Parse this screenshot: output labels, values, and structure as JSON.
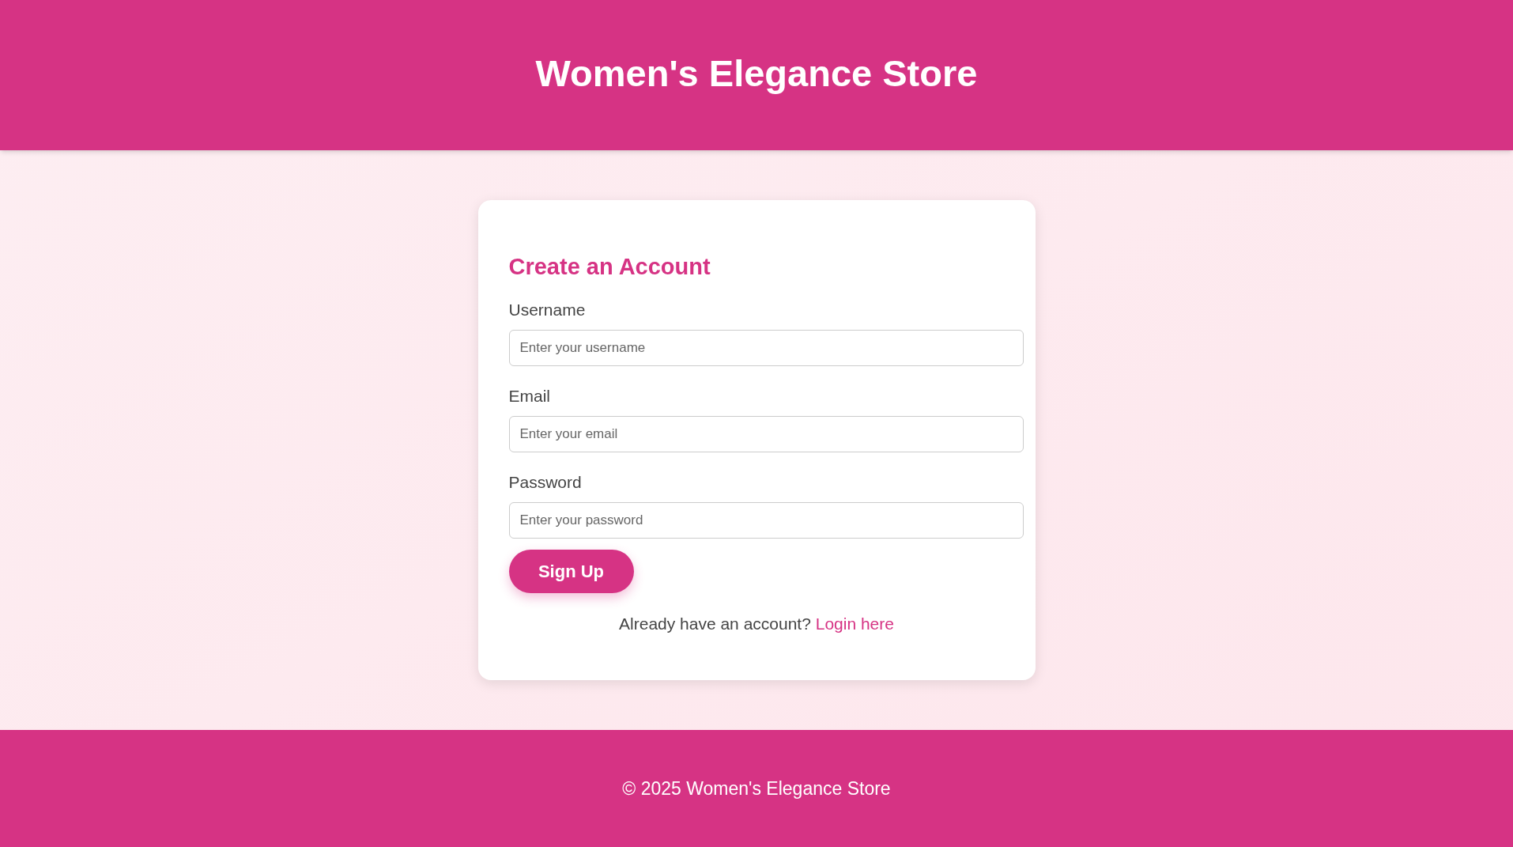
{
  "header": {
    "title": "Women's Elegance Store"
  },
  "form": {
    "title": "Create an Account",
    "fields": [
      {
        "label": "Username",
        "placeholder": "Enter your username"
      },
      {
        "label": "Email",
        "placeholder": "Enter your email"
      },
      {
        "label": "Password",
        "placeholder": "Enter your password"
      }
    ],
    "submit": "Sign Up",
    "prompt": "Already have an account?",
    "link": "Login here"
  },
  "footer": {
    "text": "© 2025 Women's Elegance Store"
  }
}
